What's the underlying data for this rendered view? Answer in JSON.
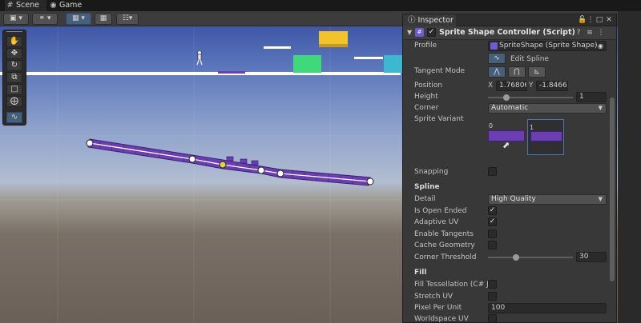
{
  "tabs": [
    {
      "label": "Scene",
      "icon": "grid-icon"
    },
    {
      "label": "Game",
      "icon": "gamepad-icon"
    }
  ],
  "colors": {
    "shape_fill": "#6b3fb3",
    "shape_edge": "#3c2275",
    "yellow_block": "#f2c42a",
    "green_block": "#3fd87a",
    "cyan_block": "#3cb8d0",
    "selected_point": "#e8d43a",
    "accent": "#46607c"
  },
  "tools": [
    "hand-icon",
    "move-icon",
    "rotate-icon",
    "scale-icon",
    "rect-icon",
    "transform-icon",
    "spline-edit-icon"
  ],
  "inspector": {
    "tab_label": "Inspector",
    "component": {
      "title": "Sprite Shape Controller (Script)",
      "enabled": true
    },
    "profile": {
      "label": "Profile",
      "value": "SpriteShape (Sprite Shape)"
    },
    "edit_spline": {
      "label": "Edit Spline"
    },
    "tangent_mode": {
      "label": "Tangent Mode",
      "options": [
        "linear-mode-icon",
        "continuous-mode-icon",
        "broken-mode-icon"
      ],
      "selected": 0
    },
    "position": {
      "label": "Position",
      "x_label": "X",
      "x_value": "1.76806",
      "y_label": "Y",
      "y_value": "-1.8466"
    },
    "height": {
      "label": "Height",
      "value": "1",
      "level": 0.22
    },
    "corner": {
      "label": "Corner",
      "value": "Automatic"
    },
    "sprite_variant": {
      "label": "Sprite Variant",
      "items": [
        "0",
        "1"
      ],
      "selected": 1
    },
    "snapping": {
      "label": "Snapping",
      "checked": false
    },
    "spline_section": "Spline",
    "detail": {
      "label": "Detail",
      "value": "High Quality"
    },
    "is_open_ended": {
      "label": "Is Open Ended",
      "checked": true
    },
    "adaptive_uv": {
      "label": "Adaptive UV",
      "checked": true
    },
    "enable_tangents": {
      "label": "Enable Tangents",
      "checked": false
    },
    "cache_geometry": {
      "label": "Cache Geometry",
      "checked": false
    },
    "corner_threshold": {
      "label": "Corner Threshold",
      "value": "30",
      "level": 0.33
    },
    "fill_section": "Fill",
    "fill_tessellation": {
      "label": "Fill Tessellation (C# Jo",
      "checked": false
    },
    "stretch_uv": {
      "label": "Stretch UV",
      "checked": false
    },
    "pixel_per_unit": {
      "label": "Pixel Per Unit",
      "value": "100"
    },
    "worldspace_uv": {
      "label": "Worldspace UV",
      "checked": false
    }
  }
}
